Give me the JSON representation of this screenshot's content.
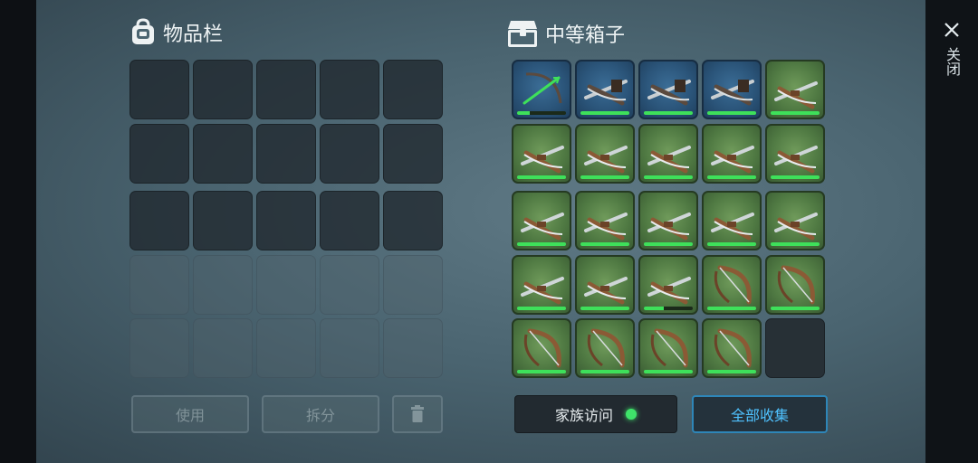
{
  "inventory": {
    "title": "物品栏",
    "icon": "backpack-icon",
    "buttons": {
      "use": "使用",
      "split": "拆分",
      "trash_icon": "trash-icon"
    }
  },
  "chest": {
    "title": "中等箱子",
    "icon": "chest-icon",
    "items": [
      {
        "kind": "arrow-bow",
        "rarity": "blue",
        "durability": 0.25
      },
      {
        "kind": "crossbow-dark",
        "rarity": "blue",
        "durability": 1.0
      },
      {
        "kind": "crossbow-dark",
        "rarity": "blue",
        "durability": 1.0
      },
      {
        "kind": "crossbow-dark",
        "rarity": "blue",
        "durability": 1.0
      },
      {
        "kind": "crossbow",
        "rarity": "green",
        "durability": 1.0
      },
      {
        "kind": "crossbow",
        "rarity": "green",
        "durability": 1.0
      },
      {
        "kind": "crossbow",
        "rarity": "green",
        "durability": 1.0
      },
      {
        "kind": "crossbow",
        "rarity": "green",
        "durability": 1.0
      },
      {
        "kind": "crossbow",
        "rarity": "green",
        "durability": 1.0
      },
      {
        "kind": "crossbow",
        "rarity": "green",
        "durability": 1.0
      },
      {
        "kind": "crossbow",
        "rarity": "green",
        "durability": 1.0
      },
      {
        "kind": "crossbow",
        "rarity": "green",
        "durability": 1.0
      },
      {
        "kind": "crossbow",
        "rarity": "green",
        "durability": 1.0
      },
      {
        "kind": "crossbow",
        "rarity": "green",
        "durability": 1.0
      },
      {
        "kind": "crossbow",
        "rarity": "green",
        "durability": 1.0
      },
      {
        "kind": "crossbow",
        "rarity": "green",
        "durability": 1.0
      },
      {
        "kind": "crossbow",
        "rarity": "green",
        "durability": 1.0
      },
      {
        "kind": "crossbow",
        "rarity": "green",
        "durability": 0.4
      },
      {
        "kind": "bow",
        "rarity": "green",
        "durability": 1.0
      },
      {
        "kind": "bow",
        "rarity": "green",
        "durability": 1.0
      },
      {
        "kind": "bow",
        "rarity": "green",
        "durability": 1.0
      },
      {
        "kind": "bow",
        "rarity": "green",
        "durability": 1.0
      },
      {
        "kind": "bow",
        "rarity": "green",
        "durability": 1.0
      },
      {
        "kind": "bow",
        "rarity": "green",
        "durability": 1.0
      }
    ],
    "buttons": {
      "family_access": "家族访问",
      "collect_all": "全部收集"
    },
    "family_access_status_color": "#3fe46a"
  },
  "close": {
    "label": "关闭",
    "icon": "close-icon"
  },
  "colors": {
    "accent": "#4fc2ff",
    "durability": "#3ee05a"
  }
}
